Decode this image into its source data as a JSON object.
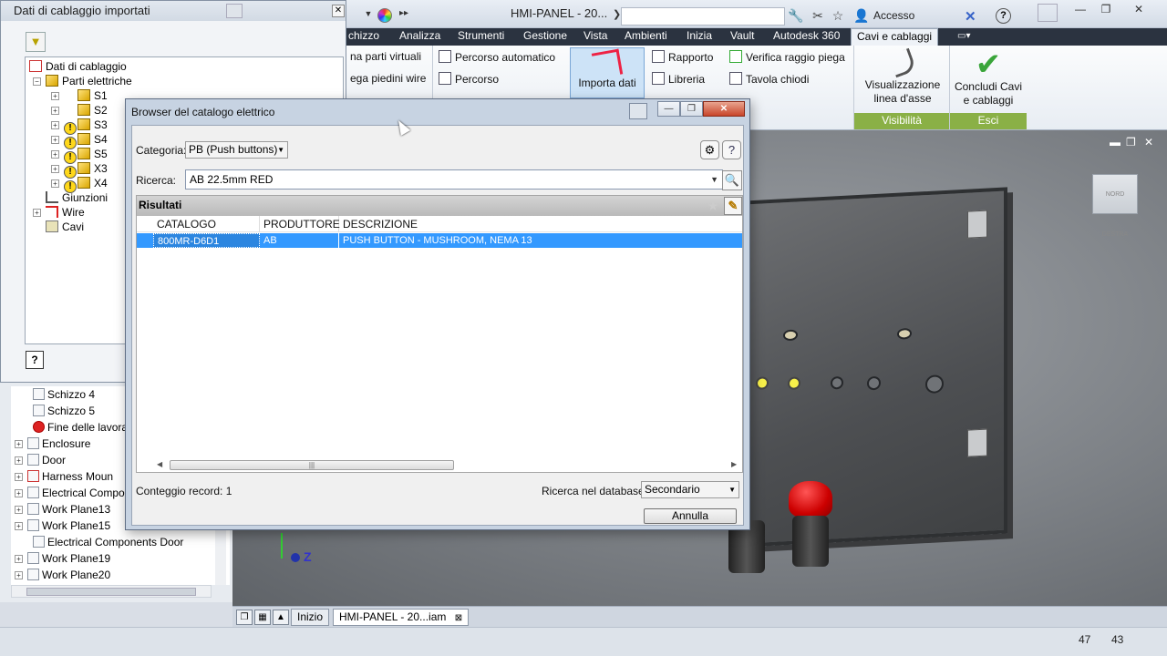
{
  "app": {
    "title": "HMI-PANEL - 20...",
    "sign_in": "Accesso"
  },
  "ribbon": {
    "tabs": [
      "chizzo",
      "Analizza",
      "Strumenti",
      "Gestione",
      "Vista",
      "Ambienti",
      "Inizia",
      "Vault",
      "Autodesk 360",
      "Cavi e cablaggi"
    ],
    "active_tab": "Cavi e cablaggi",
    "items": {
      "parti_virtuali": "na parti virtuali",
      "piedini_wire": "ega piedini wire",
      "percorso_automatico": "Percorso automatico",
      "percorso": "Percorso",
      "importa_dati": "Importa dati",
      "rapporto": "Rapporto",
      "libreria": "Libreria",
      "verifica_raggio": "Verifica raggio piega",
      "tavola_chiodi": "Tavola chiodi",
      "visualizzazione": "Visualizzazione\nlinea d'asse",
      "concludi": "Concludi Cavi\ne cablaggi"
    },
    "panels": {
      "visibilita": "Visibilità",
      "esci": "Esci"
    }
  },
  "dock": {
    "title": "Dati di cablaggio importati",
    "tree": {
      "root": "Dati di cablaggio",
      "parti": "Parti elettriche",
      "parts": [
        "S1",
        "S2",
        "S3",
        "S4",
        "S5",
        "X3",
        "X4"
      ],
      "giunzioni": "Giunzioni",
      "wire": "Wire",
      "cavi": "Cavi"
    }
  },
  "model_tree": [
    "Schizzo 4",
    "Schizzo 5",
    "Fine delle lavoraz",
    "Enclosure",
    "Door",
    "Harness Moun",
    "Electrical Compor",
    "Work Plane13",
    "Work Plane15",
    "Electrical Components Door",
    "Work Plane19",
    "Work Plane20"
  ],
  "viewcube": "NORD DESTRA",
  "doc_tabs": {
    "home": "Inizio",
    "doc": "HMI-PANEL - 20...iam"
  },
  "status": {
    "a": "47",
    "b": "43"
  },
  "dialog": {
    "title": "Browser del catalogo elettrico",
    "category_label": "Categoria:",
    "category_value": "PB (Push buttons)",
    "search_label": "Ricerca:",
    "search_value": "AB 22.5mm RED",
    "results_label": "Risultati",
    "columns": [
      "CATALOGO",
      "PRODUTTORE",
      "DESCRIZIONE"
    ],
    "rows": [
      {
        "catalogo": "800MR-D6D1",
        "produttore": "AB",
        "descrizione": "PUSH BUTTON - MUSHROOM, NEMA 13"
      }
    ],
    "record_count": "Conteggio record: 1",
    "db_label": "Ricerca nel database:",
    "db_value": "Secondario",
    "cancel": "Annulla"
  },
  "colors": {
    "ribbon_active": "#eef2f7",
    "selection": "#3399ff",
    "panel_green": "#8ab046"
  }
}
